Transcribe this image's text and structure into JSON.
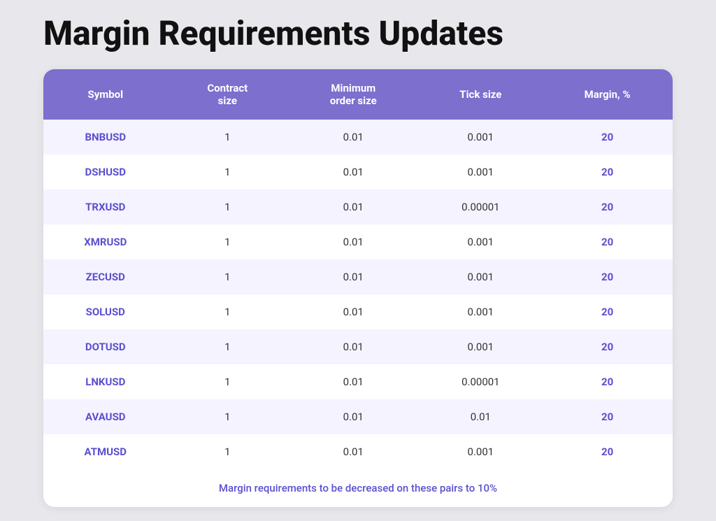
{
  "page": {
    "title": "Margin Requirements Updates",
    "footer_note": "Margin requirements to be decreased on these pairs to 10%"
  },
  "table": {
    "headers": [
      {
        "id": "symbol",
        "label": "Symbol"
      },
      {
        "id": "contract_size",
        "label": "Contract size"
      },
      {
        "id": "min_order_size",
        "label": "Minimum order size"
      },
      {
        "id": "tick_size",
        "label": "Tick size"
      },
      {
        "id": "margin",
        "label": "Margin, %"
      }
    ],
    "rows": [
      {
        "symbol": "BNBUSD",
        "contract_size": "1",
        "min_order_size": "0.01",
        "tick_size": "0.001",
        "margin": "20"
      },
      {
        "symbol": "DSHUSD",
        "contract_size": "1",
        "min_order_size": "0.01",
        "tick_size": "0.001",
        "margin": "20"
      },
      {
        "symbol": "TRXUSD",
        "contract_size": "1",
        "min_order_size": "0.01",
        "tick_size": "0.00001",
        "margin": "20"
      },
      {
        "symbol": "XMRUSD",
        "contract_size": "1",
        "min_order_size": "0.01",
        "tick_size": "0.001",
        "margin": "20"
      },
      {
        "symbol": "ZECUSD",
        "contract_size": "1",
        "min_order_size": "0.01",
        "tick_size": "0.001",
        "margin": "20"
      },
      {
        "symbol": "SOLUSD",
        "contract_size": "1",
        "min_order_size": "0.01",
        "tick_size": "0.001",
        "margin": "20"
      },
      {
        "symbol": "DOTUSD",
        "contract_size": "1",
        "min_order_size": "0.01",
        "tick_size": "0.001",
        "margin": "20"
      },
      {
        "symbol": "LNKUSD",
        "contract_size": "1",
        "min_order_size": "0.01",
        "tick_size": "0.00001",
        "margin": "20"
      },
      {
        "symbol": "AVAUSD",
        "contract_size": "1",
        "min_order_size": "0.01",
        "tick_size": "0.01",
        "margin": "20"
      },
      {
        "symbol": "ATMUSD",
        "contract_size": "1",
        "min_order_size": "0.01",
        "tick_size": "0.001",
        "margin": "20"
      }
    ]
  }
}
